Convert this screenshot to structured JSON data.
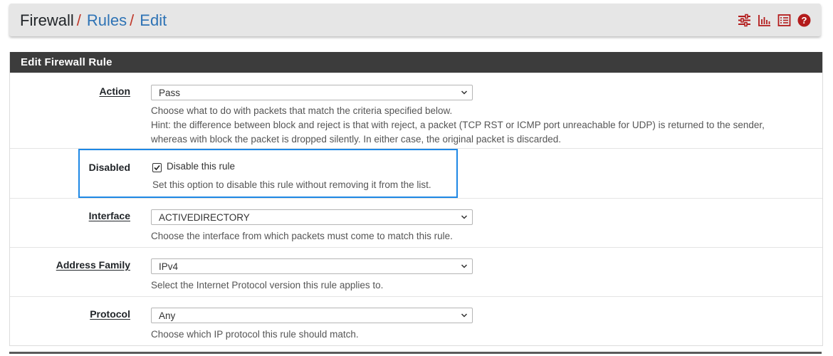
{
  "breadcrumb": {
    "first": "Firewall",
    "sep": "/",
    "second": "Rules",
    "third": "Edit"
  },
  "toolbar": {
    "icons": [
      "sliders-icon",
      "bar-chart-icon",
      "list-icon",
      "help-icon"
    ],
    "icon_color": "#b31b1b"
  },
  "panel": {
    "title": "Edit Firewall Rule"
  },
  "action": {
    "label": "Action",
    "value": "Pass",
    "help1": "Choose what to do with packets that match the criteria specified below.",
    "help2": "Hint: the difference between block and reject is that with reject, a packet (TCP RST or ICMP port unreachable for UDP) is returned to the sender,",
    "help3": "whereas with block the packet is dropped silently. In either case, the original packet is discarded."
  },
  "disabled": {
    "label": "Disabled",
    "checked": true,
    "check_label": "Disable this rule",
    "help": "Set this option to disable this rule without removing it from the list."
  },
  "interface": {
    "label": "Interface",
    "value": "ACTIVEDIRECTORY",
    "help": "Choose the interface from which packets must come to match this rule."
  },
  "family": {
    "label": "Address Family",
    "value": "IPv4",
    "help": "Select the Internet Protocol version this rule applies to."
  },
  "protocol": {
    "label": "Protocol",
    "value": "Any",
    "help": "Choose which IP protocol this rule should match."
  },
  "colors": {
    "accent": "#2e73b5",
    "header_bg": "#3c3c3c",
    "highlight": "#1e88e5"
  }
}
